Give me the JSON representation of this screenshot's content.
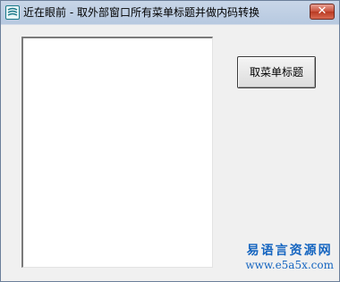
{
  "window": {
    "title": "近在眼前 - 取外部窗口所有菜单标题并做内码转换",
    "icon": "app-icon",
    "close_label": "✕"
  },
  "main": {
    "button_label": "取菜单标题"
  },
  "watermark": {
    "line1": "易语言资源网",
    "line2": "www.e5a5x.com"
  },
  "colors": {
    "watermark": "#1565c0",
    "close_button": "#c9503a"
  }
}
